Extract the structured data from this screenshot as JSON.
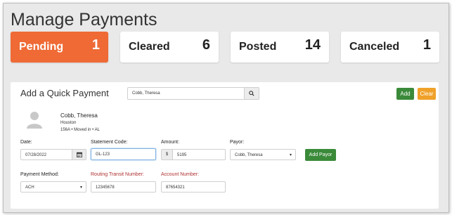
{
  "page": {
    "title": "Manage Payments"
  },
  "status_cards": [
    {
      "label": "Pending",
      "count": "1"
    },
    {
      "label": "Cleared",
      "count": "6"
    },
    {
      "label": "Posted",
      "count": "14"
    },
    {
      "label": "Canceled",
      "count": "1"
    }
  ],
  "quick_payment": {
    "title": "Add a Quick Payment",
    "search_value": "Cobb, Theresa",
    "add_label": "Add",
    "clear_label": "Clear"
  },
  "customer": {
    "name": "Cobb, Theresa",
    "city": "Houston",
    "meta": "156A • Moved in • AL"
  },
  "form": {
    "date_label": "Date:",
    "date_value": "07/28/2022",
    "statement_label": "Statement Code:",
    "statement_value": "GL-123",
    "amount_label": "Amount:",
    "amount_prefix": "$",
    "amount_value": "5195",
    "payor_label": "Payor:",
    "payor_value": "Cobb, Theresa",
    "add_payor_label": "Add Payor",
    "method_label": "Payment Method:",
    "method_value": "ACH",
    "routing_label": "Routing Transit Number:",
    "routing_value": "12345678",
    "account_label": "Account Number:",
    "account_value": "87654321"
  },
  "colors": {
    "active_card": "#ef6a35",
    "add_button": "#3a8a3a",
    "clear_button": "#f0a12a",
    "required_label": "#b03030"
  },
  "icons": [
    "search-icon",
    "calendar-icon",
    "person-avatar-icon",
    "chevron-down-icon"
  ]
}
